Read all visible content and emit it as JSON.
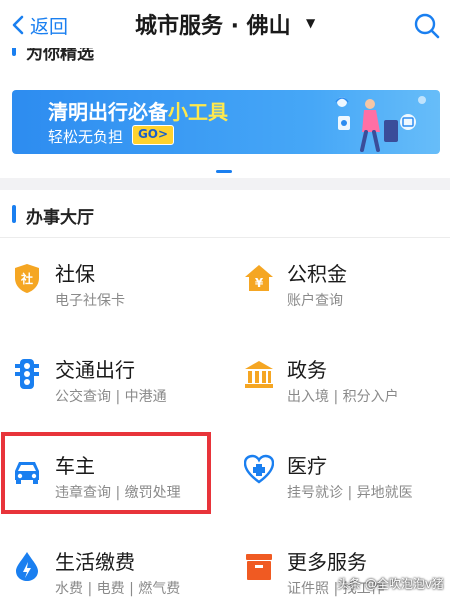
{
  "header": {
    "back_label": "返回",
    "title": "城市服务 · 佛山",
    "dropdown_caret": "▼",
    "search_icon": "search-icon"
  },
  "recommend": {
    "title": "为你精选"
  },
  "banner": {
    "title_main": "清明出行必备",
    "title_highlight": "小工具",
    "subtitle": "轻松无负担",
    "go_label": "GO>"
  },
  "hall": {
    "title": "办事大厅",
    "services": [
      {
        "name": "社保",
        "desc": "电子社保卡",
        "icon": "shield-icon",
        "color": "#f5a623"
      },
      {
        "name": "公积金",
        "desc": "账户查询",
        "icon": "house-yen-icon",
        "color": "#f5a623"
      },
      {
        "name": "交通出行",
        "desc": "公交查询 | 中港通",
        "icon": "traffic-light-icon",
        "color": "#1a7ff0"
      },
      {
        "name": "政务",
        "desc": "出入境 | 积分入户",
        "icon": "government-building-icon",
        "color": "#f5a623"
      },
      {
        "name": "车主",
        "desc": "违章查询 | 缴罚处理",
        "icon": "car-icon",
        "color": "#1a7ff0"
      },
      {
        "name": "医疗",
        "desc": "挂号就诊 | 异地就医",
        "icon": "medical-heart-icon",
        "color": "#1a7ff0"
      },
      {
        "name": "生活缴费",
        "desc": "水费 | 电费 | 燃气费",
        "icon": "water-drop-icon",
        "color": "#1a7ff0"
      },
      {
        "name": "更多服务",
        "desc": "证件照 | 找工作",
        "icon": "more-services-icon",
        "color": "#f05a22"
      }
    ]
  },
  "watermark": "头条 @全吹泡泡v猪",
  "colors": {
    "accent": "#1a7ff0",
    "highlight_box": "#e8343a",
    "banner_yellow": "#ffe94d"
  }
}
